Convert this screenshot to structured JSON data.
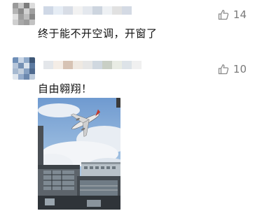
{
  "comments": [
    {
      "text": "终于能不开空调，开窗了",
      "likes": "14",
      "like_icon": "thumb-up-icon",
      "avatar_colors": [
        "#9a9a9a",
        "#c8c8c8",
        "#7d7d7d",
        "#dcdcdc",
        "#b4b4b4",
        "#8c8c8c",
        "#d2d2d2",
        "#a0a0a0",
        "#e0e0e0",
        "#9e9e9e",
        "#bebebe",
        "#888888",
        "#cfcfcf",
        "#a8a8a8",
        "#9c9c9c",
        "#c2c2c2"
      ],
      "name_colors": [
        "#cfd8e6",
        "#e6edf5",
        "#d8dde6",
        "#f2f2f2",
        "#e4e8ee",
        "#cdd5df",
        "#eef1f4",
        "#e1e1e1",
        "#d4dae4"
      ]
    },
    {
      "text": "自由翱翔！",
      "likes": "10",
      "like_icon": "thumb-up-icon",
      "avatar_colors": [
        "#6f8fb8",
        "#c9d6e6",
        "#8fa9c9",
        "#3e5777",
        "#b7c6da",
        "#7590b3",
        "#d9e2ec",
        "#5c7aa0",
        "#a6b9d0",
        "#c3cfdd",
        "#86a0c2",
        "#4f6a8f",
        "#dfe6ee",
        "#95accb",
        "#6b87ad",
        "#bccadb"
      ],
      "name_colors": [
        "#e3e6ea",
        "#f4ede6",
        "#d7c3b4",
        "#efe9e2",
        "#e6e6e6",
        "#d0d8e0",
        "#c9cfc5",
        "#e9ece4",
        "#dde3e8",
        "#f0f0f0"
      ]
    }
  ]
}
